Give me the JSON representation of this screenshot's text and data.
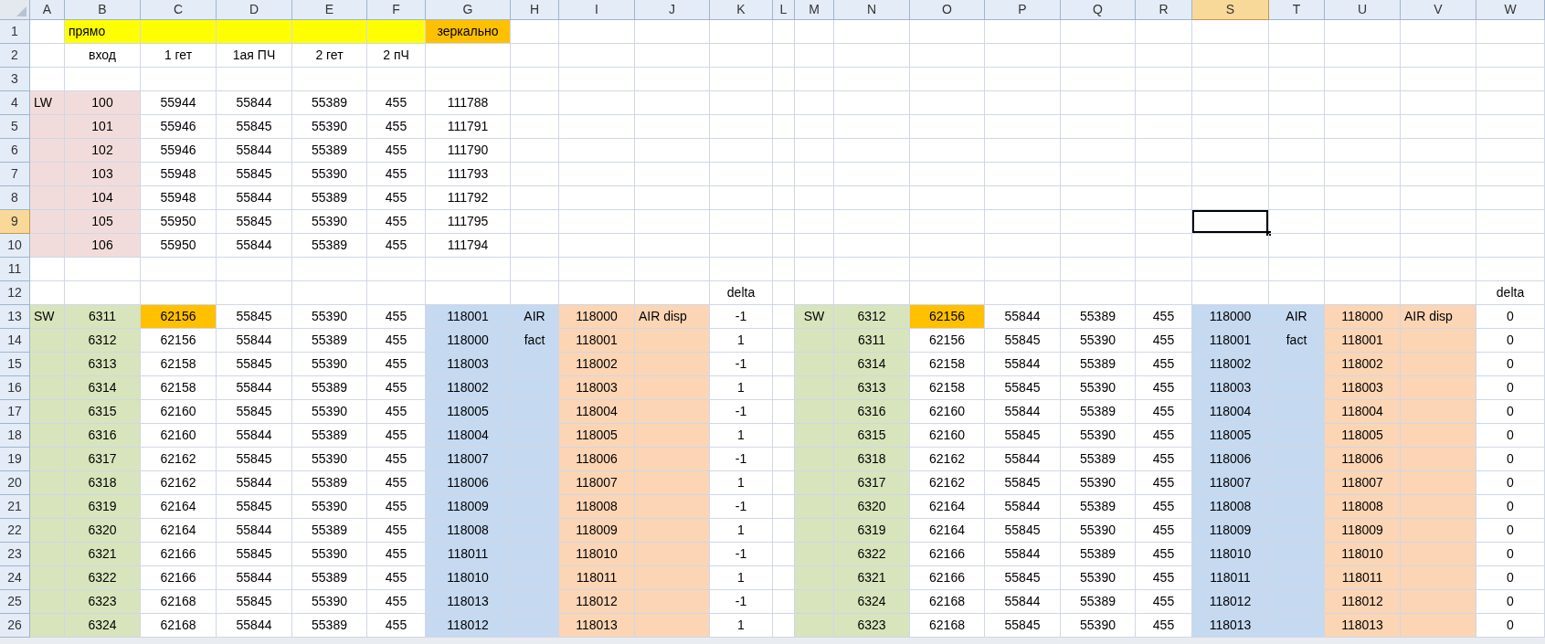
{
  "columns": [
    {
      "label": "A",
      "selected": false
    },
    {
      "label": "B",
      "selected": false
    },
    {
      "label": "C",
      "selected": false
    },
    {
      "label": "D",
      "selected": false
    },
    {
      "label": "E",
      "selected": false
    },
    {
      "label": "F",
      "selected": false
    },
    {
      "label": "G",
      "selected": false
    },
    {
      "label": "H",
      "selected": false
    },
    {
      "label": "I",
      "selected": false
    },
    {
      "label": "J",
      "selected": false
    },
    {
      "label": "K",
      "selected": false
    },
    {
      "label": "L",
      "selected": false
    },
    {
      "label": "M",
      "selected": false
    },
    {
      "label": "N",
      "selected": false
    },
    {
      "label": "O",
      "selected": false
    },
    {
      "label": "P",
      "selected": false
    },
    {
      "label": "Q",
      "selected": false
    },
    {
      "label": "R",
      "selected": false
    },
    {
      "label": "S",
      "selected": true
    },
    {
      "label": "T",
      "selected": false
    },
    {
      "label": "U",
      "selected": false
    },
    {
      "label": "V",
      "selected": false
    },
    {
      "label": "W",
      "selected": false
    }
  ],
  "rows": [
    {
      "number": "1",
      "selected": false,
      "cells": {
        "B": {
          "text": "прямо",
          "color": "#ffff00"
        },
        "C": {
          "color": "#ffff00"
        },
        "D": {
          "color": "#ffff00"
        },
        "E": {
          "color": "#ffff00"
        },
        "F": {
          "color": "#ffff00"
        },
        "G": {
          "text": "зеркально",
          "color": "#ffc000"
        }
      }
    },
    {
      "number": "2",
      "selected": false,
      "cells": {
        "B": {
          "text": "вход"
        },
        "C": {
          "text": "1 гет"
        },
        "D": {
          "text": "1ая ПЧ"
        },
        "E": {
          "text": "2 гет"
        },
        "F": {
          "text": "2 пЧ"
        }
      }
    },
    {
      "number": "3",
      "selected": false,
      "cells": {}
    },
    {
      "number": "4",
      "selected": false,
      "cells": {
        "A": {
          "text": "LW",
          "color": "#f2dcdb"
        },
        "B": {
          "text": "100",
          "color": "#f2dcdb"
        },
        "C": {
          "text": "55944"
        },
        "D": {
          "text": "55844"
        },
        "E": {
          "text": "55389"
        },
        "F": {
          "text": "455"
        },
        "G": {
          "text": "111788"
        }
      }
    },
    {
      "number": "5",
      "selected": false,
      "cells": {
        "A": {
          "color": "#f2dcdb"
        },
        "B": {
          "text": "101",
          "color": "#f2dcdb"
        },
        "C": {
          "text": "55946"
        },
        "D": {
          "text": "55845"
        },
        "E": {
          "text": "55390"
        },
        "F": {
          "text": "455"
        },
        "G": {
          "text": "111791"
        }
      }
    },
    {
      "number": "6",
      "selected": false,
      "cells": {
        "A": {
          "color": "#f2dcdb"
        },
        "B": {
          "text": "102",
          "color": "#f2dcdb"
        },
        "C": {
          "text": "55946"
        },
        "D": {
          "text": "55844"
        },
        "E": {
          "text": "55389"
        },
        "F": {
          "text": "455"
        },
        "G": {
          "text": "111790"
        }
      }
    },
    {
      "number": "7",
      "selected": false,
      "cells": {
        "A": {
          "color": "#f2dcdb"
        },
        "B": {
          "text": "103",
          "color": "#f2dcdb"
        },
        "C": {
          "text": "55948"
        },
        "D": {
          "text": "55845"
        },
        "E": {
          "text": "55390"
        },
        "F": {
          "text": "455"
        },
        "G": {
          "text": "111793"
        }
      }
    },
    {
      "number": "8",
      "selected": false,
      "cells": {
        "A": {
          "color": "#f2dcdb"
        },
        "B": {
          "text": "104",
          "color": "#f2dcdb"
        },
        "C": {
          "text": "55948"
        },
        "D": {
          "text": "55844"
        },
        "E": {
          "text": "55389"
        },
        "F": {
          "text": "455"
        },
        "G": {
          "text": "111792"
        }
      }
    },
    {
      "number": "9",
      "selected": true,
      "cells": {
        "A": {
          "color": "#f2dcdb"
        },
        "B": {
          "text": "105",
          "color": "#f2dcdb"
        },
        "C": {
          "text": "55950"
        },
        "D": {
          "text": "55845"
        },
        "E": {
          "text": "55390"
        },
        "F": {
          "text": "455"
        },
        "G": {
          "text": "111795"
        }
      }
    },
    {
      "number": "10",
      "selected": false,
      "cells": {
        "A": {
          "color": "#f2dcdb"
        },
        "B": {
          "text": "106",
          "color": "#f2dcdb"
        },
        "C": {
          "text": "55950"
        },
        "D": {
          "text": "55844"
        },
        "E": {
          "text": "55389"
        },
        "F": {
          "text": "455"
        },
        "G": {
          "text": "111794"
        }
      }
    },
    {
      "number": "11",
      "selected": false,
      "cells": {}
    },
    {
      "number": "12",
      "selected": false,
      "cells": {
        "K": {
          "text": "delta"
        },
        "W": {
          "text": "delta"
        }
      }
    },
    {
      "number": "13",
      "selected": false,
      "cells": {
        "A": {
          "text": "SW",
          "color": "#d8e4bc"
        },
        "B": {
          "text": "6311",
          "color": "#d8e4bc"
        },
        "C": {
          "text": "62156",
          "color": "#ffc000"
        },
        "D": {
          "text": "55845"
        },
        "E": {
          "text": "55390"
        },
        "F": {
          "text": "455"
        },
        "G": {
          "text": "118001",
          "color": "#c5d9f1"
        },
        "H": {
          "text": "AIR",
          "color": "#c5d9f1"
        },
        "I": {
          "text": "118000",
          "color": "#fcd5b4"
        },
        "J": {
          "text": "AIR disp",
          "color": "#fcd5b4"
        },
        "K": {
          "text": "-1"
        },
        "M": {
          "text": "SW",
          "color": "#d8e4bc"
        },
        "N": {
          "text": "6312",
          "color": "#d8e4bc"
        },
        "O": {
          "text": "62156",
          "color": "#ffc000"
        },
        "P": {
          "text": "55844"
        },
        "Q": {
          "text": "55389"
        },
        "R": {
          "text": "455"
        },
        "S": {
          "text": "118000",
          "color": "#c5d9f1"
        },
        "T": {
          "text": "AIR",
          "color": "#c5d9f1"
        },
        "U": {
          "text": "118000",
          "color": "#fcd5b4"
        },
        "V": {
          "text": "AIR disp",
          "color": "#fcd5b4"
        },
        "W": {
          "text": "0"
        }
      }
    },
    {
      "number": "14",
      "selected": false,
      "cells": {
        "A": {
          "color": "#d8e4bc"
        },
        "B": {
          "text": "6312",
          "color": "#d8e4bc"
        },
        "C": {
          "text": "62156"
        },
        "D": {
          "text": "55844"
        },
        "E": {
          "text": "55389"
        },
        "F": {
          "text": "455"
        },
        "G": {
          "text": "118000",
          "color": "#c5d9f1"
        },
        "H": {
          "text": "fact",
          "color": "#c5d9f1"
        },
        "I": {
          "text": "118001",
          "color": "#fcd5b4"
        },
        "J": {
          "color": "#fcd5b4"
        },
        "K": {
          "text": "1"
        },
        "M": {
          "color": "#d8e4bc"
        },
        "N": {
          "text": "6311",
          "color": "#d8e4bc"
        },
        "O": {
          "text": "62156"
        },
        "P": {
          "text": "55845"
        },
        "Q": {
          "text": "55390"
        },
        "R": {
          "text": "455"
        },
        "S": {
          "text": "118001",
          "color": "#c5d9f1"
        },
        "T": {
          "text": "fact",
          "color": "#c5d9f1"
        },
        "U": {
          "text": "118001",
          "color": "#fcd5b4"
        },
        "V": {
          "color": "#fcd5b4"
        },
        "W": {
          "text": "0"
        }
      }
    },
    {
      "number": "15",
      "selected": false,
      "cells": {
        "A": {
          "color": "#d8e4bc"
        },
        "B": {
          "text": "6313",
          "color": "#d8e4bc"
        },
        "C": {
          "text": "62158"
        },
        "D": {
          "text": "55845"
        },
        "E": {
          "text": "55390"
        },
        "F": {
          "text": "455"
        },
        "G": {
          "text": "118003",
          "color": "#c5d9f1"
        },
        "H": {
          "color": "#c5d9f1"
        },
        "I": {
          "text": "118002",
          "color": "#fcd5b4"
        },
        "J": {
          "color": "#fcd5b4"
        },
        "K": {
          "text": "-1"
        },
        "M": {
          "color": "#d8e4bc"
        },
        "N": {
          "text": "6314",
          "color": "#d8e4bc"
        },
        "O": {
          "text": "62158"
        },
        "P": {
          "text": "55844"
        },
        "Q": {
          "text": "55389"
        },
        "R": {
          "text": "455"
        },
        "S": {
          "text": "118002",
          "color": "#c5d9f1"
        },
        "T": {
          "color": "#c5d9f1"
        },
        "U": {
          "text": "118002",
          "color": "#fcd5b4"
        },
        "V": {
          "color": "#fcd5b4"
        },
        "W": {
          "text": "0"
        }
      }
    },
    {
      "number": "16",
      "selected": false,
      "cells": {
        "A": {
          "color": "#d8e4bc"
        },
        "B": {
          "text": "6314",
          "color": "#d8e4bc"
        },
        "C": {
          "text": "62158"
        },
        "D": {
          "text": "55844"
        },
        "E": {
          "text": "55389"
        },
        "F": {
          "text": "455"
        },
        "G": {
          "text": "118002",
          "color": "#c5d9f1"
        },
        "H": {
          "color": "#c5d9f1"
        },
        "I": {
          "text": "118003",
          "color": "#fcd5b4"
        },
        "J": {
          "color": "#fcd5b4"
        },
        "K": {
          "text": "1"
        },
        "M": {
          "color": "#d8e4bc"
        },
        "N": {
          "text": "6313",
          "color": "#d8e4bc"
        },
        "O": {
          "text": "62158"
        },
        "P": {
          "text": "55845"
        },
        "Q": {
          "text": "55390"
        },
        "R": {
          "text": "455"
        },
        "S": {
          "text": "118003",
          "color": "#c5d9f1"
        },
        "T": {
          "color": "#c5d9f1"
        },
        "U": {
          "text": "118003",
          "color": "#fcd5b4"
        },
        "V": {
          "color": "#fcd5b4"
        },
        "W": {
          "text": "0"
        }
      }
    },
    {
      "number": "17",
      "selected": false,
      "cells": {
        "A": {
          "color": "#d8e4bc"
        },
        "B": {
          "text": "6315",
          "color": "#d8e4bc"
        },
        "C": {
          "text": "62160"
        },
        "D": {
          "text": "55845"
        },
        "E": {
          "text": "55390"
        },
        "F": {
          "text": "455"
        },
        "G": {
          "text": "118005",
          "color": "#c5d9f1"
        },
        "H": {
          "color": "#c5d9f1"
        },
        "I": {
          "text": "118004",
          "color": "#fcd5b4"
        },
        "J": {
          "color": "#fcd5b4"
        },
        "K": {
          "text": "-1"
        },
        "M": {
          "color": "#d8e4bc"
        },
        "N": {
          "text": "6316",
          "color": "#d8e4bc"
        },
        "O": {
          "text": "62160"
        },
        "P": {
          "text": "55844"
        },
        "Q": {
          "text": "55389"
        },
        "R": {
          "text": "455"
        },
        "S": {
          "text": "118004",
          "color": "#c5d9f1"
        },
        "T": {
          "color": "#c5d9f1"
        },
        "U": {
          "text": "118004",
          "color": "#fcd5b4"
        },
        "V": {
          "color": "#fcd5b4"
        },
        "W": {
          "text": "0"
        }
      }
    },
    {
      "number": "18",
      "selected": false,
      "cells": {
        "A": {
          "color": "#d8e4bc"
        },
        "B": {
          "text": "6316",
          "color": "#d8e4bc"
        },
        "C": {
          "text": "62160"
        },
        "D": {
          "text": "55844"
        },
        "E": {
          "text": "55389"
        },
        "F": {
          "text": "455"
        },
        "G": {
          "text": "118004",
          "color": "#c5d9f1"
        },
        "H": {
          "color": "#c5d9f1"
        },
        "I": {
          "text": "118005",
          "color": "#fcd5b4"
        },
        "J": {
          "color": "#fcd5b4"
        },
        "K": {
          "text": "1"
        },
        "M": {
          "color": "#d8e4bc"
        },
        "N": {
          "text": "6315",
          "color": "#d8e4bc"
        },
        "O": {
          "text": "62160"
        },
        "P": {
          "text": "55845"
        },
        "Q": {
          "text": "55390"
        },
        "R": {
          "text": "455"
        },
        "S": {
          "text": "118005",
          "color": "#c5d9f1"
        },
        "T": {
          "color": "#c5d9f1"
        },
        "U": {
          "text": "118005",
          "color": "#fcd5b4"
        },
        "V": {
          "color": "#fcd5b4"
        },
        "W": {
          "text": "0"
        }
      }
    },
    {
      "number": "19",
      "selected": false,
      "cells": {
        "A": {
          "color": "#d8e4bc"
        },
        "B": {
          "text": "6317",
          "color": "#d8e4bc"
        },
        "C": {
          "text": "62162"
        },
        "D": {
          "text": "55845"
        },
        "E": {
          "text": "55390"
        },
        "F": {
          "text": "455"
        },
        "G": {
          "text": "118007",
          "color": "#c5d9f1"
        },
        "H": {
          "color": "#c5d9f1"
        },
        "I": {
          "text": "118006",
          "color": "#fcd5b4"
        },
        "J": {
          "color": "#fcd5b4"
        },
        "K": {
          "text": "-1"
        },
        "M": {
          "color": "#d8e4bc"
        },
        "N": {
          "text": "6318",
          "color": "#d8e4bc"
        },
        "O": {
          "text": "62162"
        },
        "P": {
          "text": "55844"
        },
        "Q": {
          "text": "55389"
        },
        "R": {
          "text": "455"
        },
        "S": {
          "text": "118006",
          "color": "#c5d9f1"
        },
        "T": {
          "color": "#c5d9f1"
        },
        "U": {
          "text": "118006",
          "color": "#fcd5b4"
        },
        "V": {
          "color": "#fcd5b4"
        },
        "W": {
          "text": "0"
        }
      }
    },
    {
      "number": "20",
      "selected": false,
      "cells": {
        "A": {
          "color": "#d8e4bc"
        },
        "B": {
          "text": "6318",
          "color": "#d8e4bc"
        },
        "C": {
          "text": "62162"
        },
        "D": {
          "text": "55844"
        },
        "E": {
          "text": "55389"
        },
        "F": {
          "text": "455"
        },
        "G": {
          "text": "118006",
          "color": "#c5d9f1"
        },
        "H": {
          "color": "#c5d9f1"
        },
        "I": {
          "text": "118007",
          "color": "#fcd5b4"
        },
        "J": {
          "color": "#fcd5b4"
        },
        "K": {
          "text": "1"
        },
        "M": {
          "color": "#d8e4bc"
        },
        "N": {
          "text": "6317",
          "color": "#d8e4bc"
        },
        "O": {
          "text": "62162"
        },
        "P": {
          "text": "55845"
        },
        "Q": {
          "text": "55390"
        },
        "R": {
          "text": "455"
        },
        "S": {
          "text": "118007",
          "color": "#c5d9f1"
        },
        "T": {
          "color": "#c5d9f1"
        },
        "U": {
          "text": "118007",
          "color": "#fcd5b4"
        },
        "V": {
          "color": "#fcd5b4"
        },
        "W": {
          "text": "0"
        }
      }
    },
    {
      "number": "21",
      "selected": false,
      "cells": {
        "A": {
          "color": "#d8e4bc"
        },
        "B": {
          "text": "6319",
          "color": "#d8e4bc"
        },
        "C": {
          "text": "62164"
        },
        "D": {
          "text": "55845"
        },
        "E": {
          "text": "55390"
        },
        "F": {
          "text": "455"
        },
        "G": {
          "text": "118009",
          "color": "#c5d9f1"
        },
        "H": {
          "color": "#c5d9f1"
        },
        "I": {
          "text": "118008",
          "color": "#fcd5b4"
        },
        "J": {
          "color": "#fcd5b4"
        },
        "K": {
          "text": "-1"
        },
        "M": {
          "color": "#d8e4bc"
        },
        "N": {
          "text": "6320",
          "color": "#d8e4bc"
        },
        "O": {
          "text": "62164"
        },
        "P": {
          "text": "55844"
        },
        "Q": {
          "text": "55389"
        },
        "R": {
          "text": "455"
        },
        "S": {
          "text": "118008",
          "color": "#c5d9f1"
        },
        "T": {
          "color": "#c5d9f1"
        },
        "U": {
          "text": "118008",
          "color": "#fcd5b4"
        },
        "V": {
          "color": "#fcd5b4"
        },
        "W": {
          "text": "0"
        }
      }
    },
    {
      "number": "22",
      "selected": false,
      "cells": {
        "A": {
          "color": "#d8e4bc"
        },
        "B": {
          "text": "6320",
          "color": "#d8e4bc"
        },
        "C": {
          "text": "62164"
        },
        "D": {
          "text": "55844"
        },
        "E": {
          "text": "55389"
        },
        "F": {
          "text": "455"
        },
        "G": {
          "text": "118008",
          "color": "#c5d9f1"
        },
        "H": {
          "color": "#c5d9f1"
        },
        "I": {
          "text": "118009",
          "color": "#fcd5b4"
        },
        "J": {
          "color": "#fcd5b4"
        },
        "K": {
          "text": "1"
        },
        "M": {
          "color": "#d8e4bc"
        },
        "N": {
          "text": "6319",
          "color": "#d8e4bc"
        },
        "O": {
          "text": "62164"
        },
        "P": {
          "text": "55845"
        },
        "Q": {
          "text": "55390"
        },
        "R": {
          "text": "455"
        },
        "S": {
          "text": "118009",
          "color": "#c5d9f1"
        },
        "T": {
          "color": "#c5d9f1"
        },
        "U": {
          "text": "118009",
          "color": "#fcd5b4"
        },
        "V": {
          "color": "#fcd5b4"
        },
        "W": {
          "text": "0"
        }
      }
    },
    {
      "number": "23",
      "selected": false,
      "cells": {
        "A": {
          "color": "#d8e4bc"
        },
        "B": {
          "text": "6321",
          "color": "#d8e4bc"
        },
        "C": {
          "text": "62166"
        },
        "D": {
          "text": "55845"
        },
        "E": {
          "text": "55390"
        },
        "F": {
          "text": "455"
        },
        "G": {
          "text": "118011",
          "color": "#c5d9f1"
        },
        "H": {
          "color": "#c5d9f1"
        },
        "I": {
          "text": "118010",
          "color": "#fcd5b4"
        },
        "J": {
          "color": "#fcd5b4"
        },
        "K": {
          "text": "-1"
        },
        "M": {
          "color": "#d8e4bc"
        },
        "N": {
          "text": "6322",
          "color": "#d8e4bc"
        },
        "O": {
          "text": "62166"
        },
        "P": {
          "text": "55844"
        },
        "Q": {
          "text": "55389"
        },
        "R": {
          "text": "455"
        },
        "S": {
          "text": "118010",
          "color": "#c5d9f1"
        },
        "T": {
          "color": "#c5d9f1"
        },
        "U": {
          "text": "118010",
          "color": "#fcd5b4"
        },
        "V": {
          "color": "#fcd5b4"
        },
        "W": {
          "text": "0"
        }
      }
    },
    {
      "number": "24",
      "selected": false,
      "cells": {
        "A": {
          "color": "#d8e4bc"
        },
        "B": {
          "text": "6322",
          "color": "#d8e4bc"
        },
        "C": {
          "text": "62166"
        },
        "D": {
          "text": "55844"
        },
        "E": {
          "text": "55389"
        },
        "F": {
          "text": "455"
        },
        "G": {
          "text": "118010",
          "color": "#c5d9f1"
        },
        "H": {
          "color": "#c5d9f1"
        },
        "I": {
          "text": "118011",
          "color": "#fcd5b4"
        },
        "J": {
          "color": "#fcd5b4"
        },
        "K": {
          "text": "1"
        },
        "M": {
          "color": "#d8e4bc"
        },
        "N": {
          "text": "6321",
          "color": "#d8e4bc"
        },
        "O": {
          "text": "62166"
        },
        "P": {
          "text": "55845"
        },
        "Q": {
          "text": "55390"
        },
        "R": {
          "text": "455"
        },
        "S": {
          "text": "118011",
          "color": "#c5d9f1"
        },
        "T": {
          "color": "#c5d9f1"
        },
        "U": {
          "text": "118011",
          "color": "#fcd5b4"
        },
        "V": {
          "color": "#fcd5b4"
        },
        "W": {
          "text": "0"
        }
      }
    },
    {
      "number": "25",
      "selected": false,
      "cells": {
        "A": {
          "color": "#d8e4bc"
        },
        "B": {
          "text": "6323",
          "color": "#d8e4bc"
        },
        "C": {
          "text": "62168"
        },
        "D": {
          "text": "55845"
        },
        "E": {
          "text": "55390"
        },
        "F": {
          "text": "455"
        },
        "G": {
          "text": "118013",
          "color": "#c5d9f1"
        },
        "H": {
          "color": "#c5d9f1"
        },
        "I": {
          "text": "118012",
          "color": "#fcd5b4"
        },
        "J": {
          "color": "#fcd5b4"
        },
        "K": {
          "text": "-1"
        },
        "M": {
          "color": "#d8e4bc"
        },
        "N": {
          "text": "6324",
          "color": "#d8e4bc"
        },
        "O": {
          "text": "62168"
        },
        "P": {
          "text": "55844"
        },
        "Q": {
          "text": "55389"
        },
        "R": {
          "text": "455"
        },
        "S": {
          "text": "118012",
          "color": "#c5d9f1"
        },
        "T": {
          "color": "#c5d9f1"
        },
        "U": {
          "text": "118012",
          "color": "#fcd5b4"
        },
        "V": {
          "color": "#fcd5b4"
        },
        "W": {
          "text": "0"
        }
      }
    },
    {
      "number": "26",
      "selected": false,
      "cells": {
        "A": {
          "color": "#d8e4bc"
        },
        "B": {
          "text": "6324",
          "color": "#d8e4bc"
        },
        "C": {
          "text": "62168"
        },
        "D": {
          "text": "55844"
        },
        "E": {
          "text": "55389"
        },
        "F": {
          "text": "455"
        },
        "G": {
          "text": "118012",
          "color": "#c5d9f1"
        },
        "H": {
          "color": "#c5d9f1"
        },
        "I": {
          "text": "118013",
          "color": "#fcd5b4"
        },
        "J": {
          "color": "#fcd5b4"
        },
        "K": {
          "text": "1"
        },
        "M": {
          "color": "#d8e4bc"
        },
        "N": {
          "text": "6323",
          "color": "#d8e4bc"
        },
        "O": {
          "text": "62168"
        },
        "P": {
          "text": "55845"
        },
        "Q": {
          "text": "55390"
        },
        "R": {
          "text": "455"
        },
        "S": {
          "text": "118013",
          "color": "#c5d9f1"
        },
        "T": {
          "color": "#c5d9f1"
        },
        "U": {
          "text": "118013",
          "color": "#fcd5b4"
        },
        "V": {
          "color": "#fcd5b4"
        },
        "W": {
          "text": "0"
        }
      }
    }
  ]
}
